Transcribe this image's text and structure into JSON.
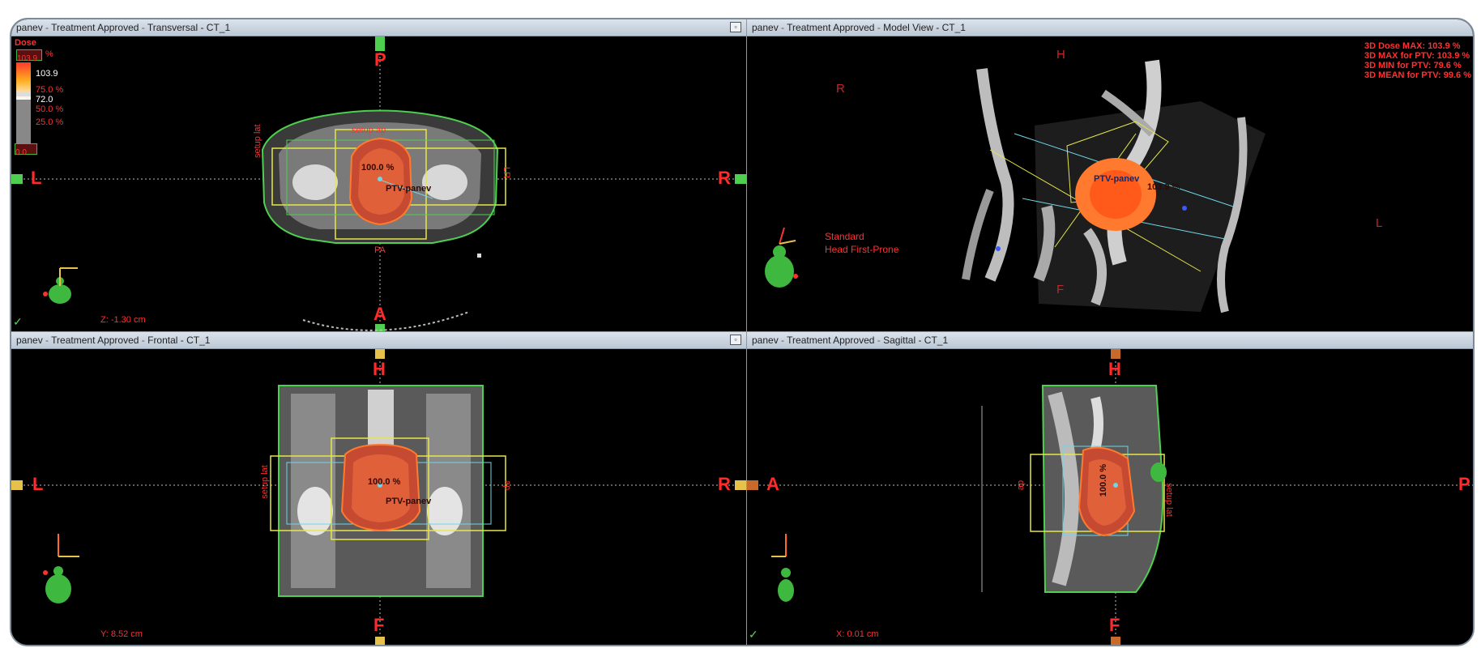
{
  "panes": {
    "transversal": {
      "title_user": "panev",
      "title_sep": " - ",
      "title_status": "Treatment Approved",
      "title_view": "Transversal - CT_1",
      "top_label": "P",
      "bottom_label": "A",
      "left_label": "L",
      "right_label": "R",
      "coord_text": "Z: -1.30 cm",
      "dose_label": "Dose",
      "dose_box_value": "103.9",
      "dose_unit": "%",
      "dose_max": "103.9",
      "dose_levels": [
        "75.0 %",
        "72.0",
        "50.0 %",
        "25.0 %"
      ],
      "dose_min_box": "0.0",
      "isodose_label": "100.0 %",
      "ptv_label": "PTV-panev",
      "field_top": "setup ap",
      "field_left": "setup lat",
      "field_right": "LR",
      "field_bottom": "PA"
    },
    "model": {
      "title_user": "panev",
      "title_status": "Treatment Approved",
      "title_view": "Model View - CT_1",
      "head_label": "H",
      "foot_label": "F",
      "r_label": "R",
      "l_label": "L",
      "stats": [
        "3D Dose MAX: 103.9 %",
        "3D MAX for PTV: 103.9 %",
        "3D MIN for PTV: 79.6 %",
        "3D MEAN for PTV: 99.6 %"
      ],
      "orientation_line1": "Standard",
      "orientation_line2": "Head First-Prone",
      "ptv_label": "PTV-panev",
      "dose_label": "103.9 %"
    },
    "frontal": {
      "title_user": "panev",
      "title_status": "Treatment Approved",
      "title_view": "Frontal - CT_1",
      "top_label": "H",
      "bottom_label": "F",
      "left_label": "L",
      "right_label": "R",
      "coord_text": "Y: 8.52 cm",
      "isodose_label": "100.0 %",
      "ptv_label": "PTV-panev",
      "field_left": "setup lat",
      "field_right": "ap"
    },
    "sagittal": {
      "title_user": "panev",
      "title_status": "Treatment Approved",
      "title_view": "Sagittal - CT_1",
      "top_label": "H",
      "bottom_label": "F",
      "left_label": "A",
      "right_label": "P",
      "coord_text": "X: 0.01 cm",
      "isodose_label": "100.0 %",
      "field_left": "ap",
      "field_right": "setup lat"
    }
  },
  "colors": {
    "orientation_red": "#ff2a2a",
    "field_yellow": "#e6e64a",
    "body_green": "#49d049",
    "beam_cyan": "#6fd6e8",
    "ptv_red": "#d8482c",
    "isodose_orange": "#ff7a2e"
  }
}
